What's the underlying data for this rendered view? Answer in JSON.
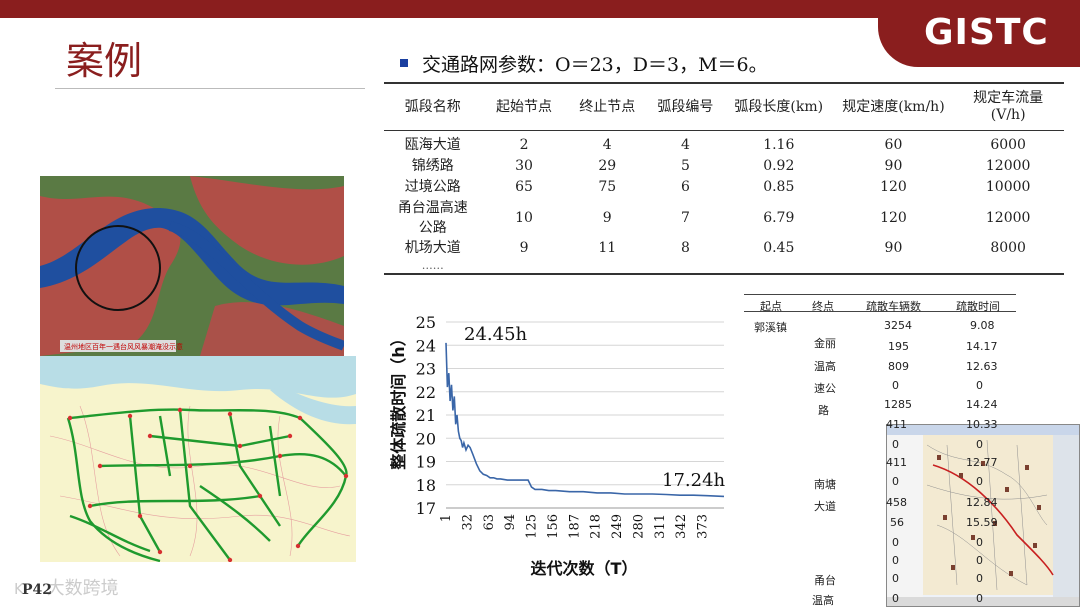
{
  "logo": "GISTC",
  "title": "案例",
  "bullet": "交通路网参数：O＝23，D＝3，M＝6。",
  "table": {
    "headers": [
      "弧段名称",
      "起始节点",
      "终止节点",
      "弧段编号",
      "弧段长度(km)",
      "规定速度(km/h)",
      "规定车流量(V/h)"
    ],
    "rows": [
      [
        "瓯海大道",
        "2",
        "4",
        "4",
        "1.16",
        "60",
        "6000"
      ],
      [
        "锦绣路",
        "30",
        "29",
        "5",
        "0.92",
        "90",
        "12000"
      ],
      [
        "过境公路",
        "65",
        "75",
        "6",
        "0.85",
        "120",
        "10000"
      ],
      [
        "甬台温高速公路",
        "10",
        "9",
        "7",
        "6.79",
        "120",
        "12000"
      ],
      [
        "机场大道",
        "9",
        "11",
        "8",
        "0.45",
        "90",
        "8000"
      ]
    ],
    "ellipsis": "……"
  },
  "map_caption": "温州地区百年一遇台风风暴潮淹没示意",
  "chart_data": {
    "type": "line",
    "ylabel": "整体疏散时间（h）",
    "xlabel": "迭代次数（T）",
    "ylim": [
      17,
      25
    ],
    "yticks": [
      "17",
      "18",
      "19",
      "20",
      "21",
      "22",
      "23",
      "24",
      "25"
    ],
    "xticks": [
      "1",
      "32",
      "63",
      "94",
      "125",
      "156",
      "187",
      "218",
      "249",
      "280",
      "311",
      "342",
      "373"
    ],
    "xlim": [
      1,
      404
    ],
    "annotations": {
      "start": "24.45h",
      "end": "17.24h"
    },
    "series": [
      {
        "x": [
          1,
          3,
          5,
          7,
          9,
          11,
          13,
          15,
          17,
          19,
          21,
          23,
          25,
          27,
          30,
          33,
          36,
          40,
          45,
          50,
          55,
          60,
          65,
          70,
          75,
          80,
          90,
          100,
          110,
          120,
          125,
          130,
          140,
          150,
          160,
          180,
          200,
          220,
          240,
          260,
          280,
          300,
          320,
          340,
          360,
          380,
          404
        ],
        "y": [
          24.1,
          22.2,
          22.8,
          21.6,
          22.3,
          21.2,
          21.8,
          20.6,
          21.0,
          20.3,
          20.0,
          19.9,
          19.6,
          19.8,
          19.5,
          19.7,
          19.6,
          19.3,
          18.9,
          18.6,
          18.45,
          18.4,
          18.3,
          18.3,
          18.25,
          18.25,
          18.2,
          18.2,
          18.2,
          18.2,
          17.9,
          17.8,
          17.8,
          17.75,
          17.75,
          17.7,
          17.7,
          17.65,
          17.65,
          17.6,
          17.6,
          17.6,
          17.58,
          17.55,
          17.55,
          17.53,
          17.5
        ]
      }
    ]
  },
  "side_table": {
    "headers": [
      "起点",
      "终点",
      "疏散车辆数",
      "疏散时间"
    ],
    "origin": "郭溪镇",
    "dest_labels": [
      "金丽",
      "温高",
      "速公",
      "路",
      "南塘",
      "大道",
      "甬台",
      "温高"
    ],
    "counts": [
      "3254",
      "195",
      "809",
      "0",
      "1285",
      "411",
      "0",
      "411",
      "0",
      "458",
      "56",
      "0",
      "0",
      "0",
      "0",
      "0"
    ],
    "times": [
      "9.08",
      "14.17",
      "12.63",
      "0",
      "14.24",
      "10.33",
      "0",
      "12.77",
      "0",
      "12.84",
      "15.59",
      "0",
      "0",
      "0",
      "0",
      "0"
    ]
  },
  "page_number": "P42",
  "watermark": "大数跨境"
}
